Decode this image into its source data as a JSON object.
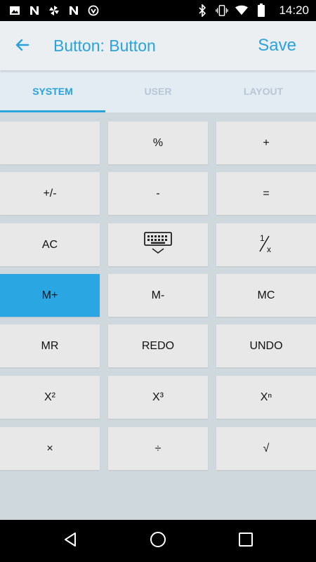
{
  "status_bar": {
    "time": "14:20",
    "left_icons": [
      "image-icon",
      "n-icon",
      "pinwheel-icon",
      "n-icon",
      "shield-icon"
    ],
    "right_icons": [
      "bluetooth-icon",
      "vibrate-icon",
      "wifi-icon",
      "battery-icon"
    ]
  },
  "app_bar": {
    "title": "Button: Button",
    "save_label": "Save"
  },
  "tabs": [
    {
      "label": "SYSTEM",
      "active": true
    },
    {
      "label": "USER",
      "active": false
    },
    {
      "label": "LAYOUT",
      "active": false
    }
  ],
  "keys": [
    [
      "",
      "%",
      "+"
    ],
    [
      "+/-",
      "-",
      "="
    ],
    [
      "AC",
      "keyboard-hide-icon",
      "1/x"
    ],
    [
      "M+",
      "M-",
      "MC"
    ],
    [
      "MR",
      "REDO",
      "UNDO"
    ],
    [
      "X²",
      "X³",
      "Xⁿ"
    ],
    [
      "×",
      "÷",
      "√"
    ]
  ],
  "selected_key": "M+",
  "colors": {
    "accent": "#29a3dd",
    "selected_key": "#2aa6e2",
    "key_bg": "#e8e8e8",
    "grid_bg": "#cfd8dc"
  }
}
